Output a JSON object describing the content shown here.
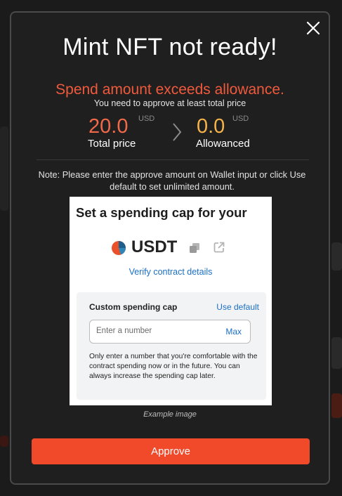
{
  "modal": {
    "title": "Mint NFT not ready!",
    "error": "Spend amount exceeds allowance.",
    "subtext": "You need to approve at least total price",
    "total": {
      "value": "20.0",
      "unit": "USD",
      "label": "Total price"
    },
    "allowance": {
      "value": "0.0",
      "unit": "USD",
      "label": "Allowanced"
    },
    "note": "Note: Please enter the approve amount on Wallet input or click Use default to set unlimited amount.",
    "approve_label": "Approve",
    "close_icon": "close-icon"
  },
  "example": {
    "title": "Set a spending cap for your",
    "token": "USDT",
    "verify_link": "Verify contract details",
    "cap_label": "Custom spending cap",
    "use_default": "Use default",
    "input_placeholder": "Enter a number",
    "max_label": "Max",
    "help_text": "Only enter a number that you're comfortable with the contract spending now or in the future. You can always increase the spending cap later.",
    "caption": "Example image"
  },
  "colors": {
    "accent": "#f04a2b",
    "error": "#f05a3c",
    "total": "#f0694a",
    "allowance": "#f6b24a",
    "link": "#1a6fc6"
  }
}
